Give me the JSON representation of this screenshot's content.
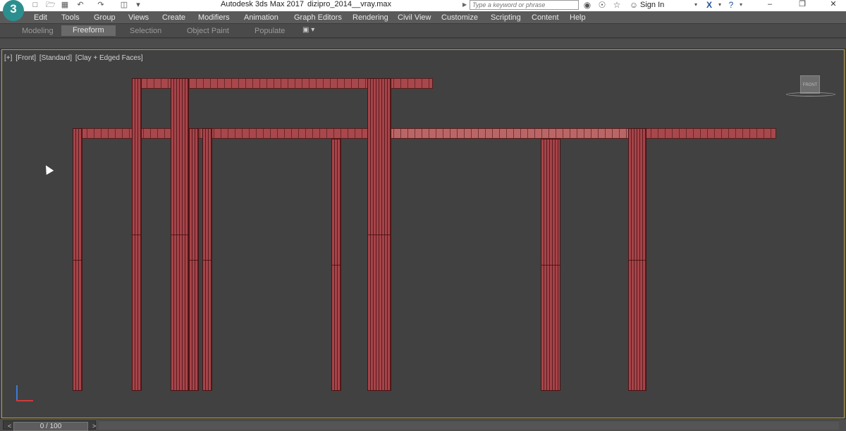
{
  "app": {
    "title": "Autodesk 3ds Max 2017",
    "file": "dizipro_2014__vray.max",
    "logo_text": "3"
  },
  "search": {
    "placeholder": "Type a keyword or phrase"
  },
  "account": {
    "sign_in": "Sign In"
  },
  "menu": [
    "Edit",
    "Tools",
    "Group",
    "Views",
    "Create",
    "Modifiers",
    "Animation",
    "Graph Editors",
    "Rendering",
    "Civil View",
    "Customize",
    "Scripting",
    "Content",
    "Help"
  ],
  "ribbon": {
    "tabs": [
      "Modeling",
      "Freeform",
      "Selection",
      "Object Paint",
      "Populate"
    ],
    "active": "Freeform"
  },
  "viewport": {
    "label_parts": [
      "[+]",
      "[Front]",
      "[Standard]",
      "[Clay + Edged Faces]"
    ],
    "viewcube_label": "FRONT",
    "object_color": "#a8484c",
    "border_color": "#b9a24a"
  },
  "timeline": {
    "frame": "0 / 100"
  },
  "icons": {
    "quick_access": [
      "new-icon",
      "open-icon",
      "save-icon",
      "undo-icon",
      "redo-icon",
      "project-icon"
    ],
    "window": [
      "minimize-icon",
      "restore-icon",
      "close-icon"
    ]
  }
}
